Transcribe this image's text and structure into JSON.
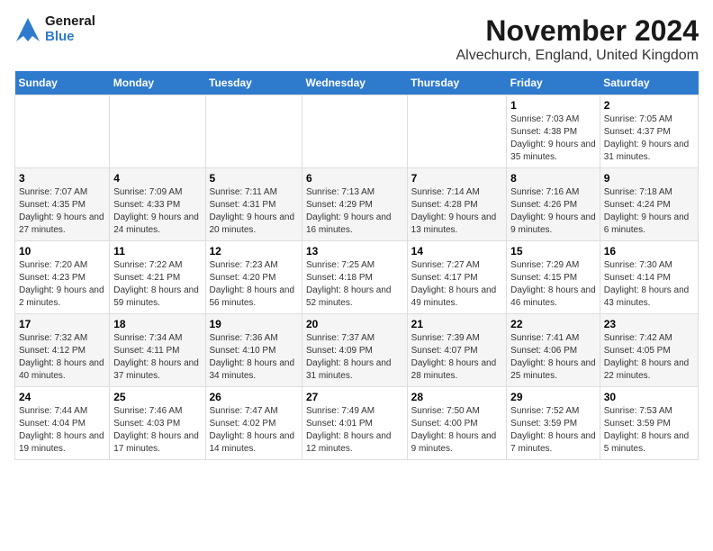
{
  "logo": {
    "line1": "General",
    "line2": "Blue"
  },
  "title": "November 2024",
  "subtitle": "Alvechurch, England, United Kingdom",
  "weekdays": [
    "Sunday",
    "Monday",
    "Tuesday",
    "Wednesday",
    "Thursday",
    "Friday",
    "Saturday"
  ],
  "weeks": [
    [
      {
        "day": "",
        "info": ""
      },
      {
        "day": "",
        "info": ""
      },
      {
        "day": "",
        "info": ""
      },
      {
        "day": "",
        "info": ""
      },
      {
        "day": "",
        "info": ""
      },
      {
        "day": "1",
        "info": "Sunrise: 7:03 AM\nSunset: 4:38 PM\nDaylight: 9 hours and 35 minutes."
      },
      {
        "day": "2",
        "info": "Sunrise: 7:05 AM\nSunset: 4:37 PM\nDaylight: 9 hours and 31 minutes."
      }
    ],
    [
      {
        "day": "3",
        "info": "Sunrise: 7:07 AM\nSunset: 4:35 PM\nDaylight: 9 hours and 27 minutes."
      },
      {
        "day": "4",
        "info": "Sunrise: 7:09 AM\nSunset: 4:33 PM\nDaylight: 9 hours and 24 minutes."
      },
      {
        "day": "5",
        "info": "Sunrise: 7:11 AM\nSunset: 4:31 PM\nDaylight: 9 hours and 20 minutes."
      },
      {
        "day": "6",
        "info": "Sunrise: 7:13 AM\nSunset: 4:29 PM\nDaylight: 9 hours and 16 minutes."
      },
      {
        "day": "7",
        "info": "Sunrise: 7:14 AM\nSunset: 4:28 PM\nDaylight: 9 hours and 13 minutes."
      },
      {
        "day": "8",
        "info": "Sunrise: 7:16 AM\nSunset: 4:26 PM\nDaylight: 9 hours and 9 minutes."
      },
      {
        "day": "9",
        "info": "Sunrise: 7:18 AM\nSunset: 4:24 PM\nDaylight: 9 hours and 6 minutes."
      }
    ],
    [
      {
        "day": "10",
        "info": "Sunrise: 7:20 AM\nSunset: 4:23 PM\nDaylight: 9 hours and 2 minutes."
      },
      {
        "day": "11",
        "info": "Sunrise: 7:22 AM\nSunset: 4:21 PM\nDaylight: 8 hours and 59 minutes."
      },
      {
        "day": "12",
        "info": "Sunrise: 7:23 AM\nSunset: 4:20 PM\nDaylight: 8 hours and 56 minutes."
      },
      {
        "day": "13",
        "info": "Sunrise: 7:25 AM\nSunset: 4:18 PM\nDaylight: 8 hours and 52 minutes."
      },
      {
        "day": "14",
        "info": "Sunrise: 7:27 AM\nSunset: 4:17 PM\nDaylight: 8 hours and 49 minutes."
      },
      {
        "day": "15",
        "info": "Sunrise: 7:29 AM\nSunset: 4:15 PM\nDaylight: 8 hours and 46 minutes."
      },
      {
        "day": "16",
        "info": "Sunrise: 7:30 AM\nSunset: 4:14 PM\nDaylight: 8 hours and 43 minutes."
      }
    ],
    [
      {
        "day": "17",
        "info": "Sunrise: 7:32 AM\nSunset: 4:12 PM\nDaylight: 8 hours and 40 minutes."
      },
      {
        "day": "18",
        "info": "Sunrise: 7:34 AM\nSunset: 4:11 PM\nDaylight: 8 hours and 37 minutes."
      },
      {
        "day": "19",
        "info": "Sunrise: 7:36 AM\nSunset: 4:10 PM\nDaylight: 8 hours and 34 minutes."
      },
      {
        "day": "20",
        "info": "Sunrise: 7:37 AM\nSunset: 4:09 PM\nDaylight: 8 hours and 31 minutes."
      },
      {
        "day": "21",
        "info": "Sunrise: 7:39 AM\nSunset: 4:07 PM\nDaylight: 8 hours and 28 minutes."
      },
      {
        "day": "22",
        "info": "Sunrise: 7:41 AM\nSunset: 4:06 PM\nDaylight: 8 hours and 25 minutes."
      },
      {
        "day": "23",
        "info": "Sunrise: 7:42 AM\nSunset: 4:05 PM\nDaylight: 8 hours and 22 minutes."
      }
    ],
    [
      {
        "day": "24",
        "info": "Sunrise: 7:44 AM\nSunset: 4:04 PM\nDaylight: 8 hours and 19 minutes."
      },
      {
        "day": "25",
        "info": "Sunrise: 7:46 AM\nSunset: 4:03 PM\nDaylight: 8 hours and 17 minutes."
      },
      {
        "day": "26",
        "info": "Sunrise: 7:47 AM\nSunset: 4:02 PM\nDaylight: 8 hours and 14 minutes."
      },
      {
        "day": "27",
        "info": "Sunrise: 7:49 AM\nSunset: 4:01 PM\nDaylight: 8 hours and 12 minutes."
      },
      {
        "day": "28",
        "info": "Sunrise: 7:50 AM\nSunset: 4:00 PM\nDaylight: 8 hours and 9 minutes."
      },
      {
        "day": "29",
        "info": "Sunrise: 7:52 AM\nSunset: 3:59 PM\nDaylight: 8 hours and 7 minutes."
      },
      {
        "day": "30",
        "info": "Sunrise: 7:53 AM\nSunset: 3:59 PM\nDaylight: 8 hours and 5 minutes."
      }
    ]
  ]
}
